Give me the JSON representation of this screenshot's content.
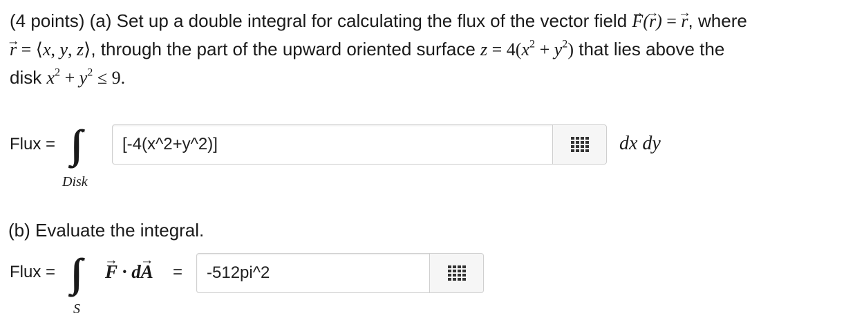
{
  "part_a": {
    "intro": "(4 points) (a) Set up a double integral for calculating the flux of the vector field ",
    "where": ", where",
    "through": ", through the part of the upward oriented surface ",
    "lies_above": " that lies above the",
    "disk_word": "disk "
  },
  "flux_a": {
    "label": "Flux =",
    "subscript": "Disk",
    "answer_value": "[-4(x^2+y^2)]",
    "differential": "dx dy"
  },
  "part_b": {
    "heading": "(b) Evaluate the integral.",
    "label": "Flux =",
    "subscript": "S",
    "equals": "=",
    "answer_value": "-512pi^2"
  },
  "icons": {
    "palette": "grid-icon"
  }
}
